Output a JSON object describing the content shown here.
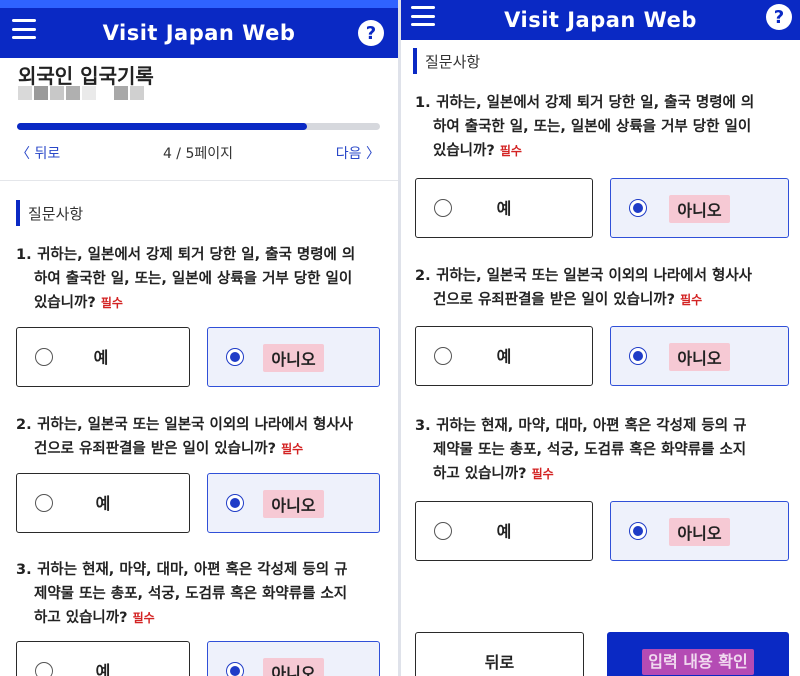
{
  "app": {
    "title": "Visit Japan Web",
    "help_glyph": "?",
    "colors": {
      "header": "#0a29c4",
      "accent": "#2f63ff",
      "required": "#d32323",
      "highlight": "#f6c9d4"
    }
  },
  "icons": {
    "menu": "menu-icon",
    "help": "help-icon",
    "radio": "radio-icon"
  },
  "left": {
    "page_title": "외국인 입국기록",
    "progress": {
      "current": 4,
      "total": 5,
      "fraction": 0.8
    },
    "pager": {
      "back": "〈  뒤로",
      "count": "4 / 5페이지",
      "next": "다음  〉"
    },
    "section_title": "질문사항",
    "questions": [
      {
        "num": "1.",
        "lines": [
          "귀하는, 일본에서 강제 퇴거 당한 일, 출국 명령에 의",
          "하여 출국한 일, 또는, 일본에 상륙을 거부 당한 일이",
          "있습니까?"
        ],
        "required": "필수",
        "yes": "예",
        "no": "아니오",
        "selected": "no"
      },
      {
        "num": "2.",
        "lines": [
          "귀하는, 일본국 또는 일본국 이외의 나라에서 형사사",
          "건으로 유죄판결을 받은 일이 있습니까?"
        ],
        "required": "필수",
        "yes": "예",
        "no": "아니오",
        "selected": "no"
      },
      {
        "num": "3.",
        "lines": [
          "귀하는 현재, 마약, 대마, 아편 혹은 각성제 등의 규",
          "제약물 또는 총포, 석궁, 도검류 혹은 화약류를 소지",
          "하고 있습니까?"
        ],
        "required": "필수",
        "yes": "예",
        "no": "아니오",
        "selected": "no"
      }
    ]
  },
  "right": {
    "section_title": "질문사항",
    "questions": [
      {
        "num": "1.",
        "lines": [
          "귀하는, 일본에서 강제 퇴거 당한 일, 출국 명령에 의",
          "하여 출국한 일, 또는, 일본에 상륙을 거부 당한 일이",
          "있습니까?"
        ],
        "required": "필수",
        "yes": "예",
        "no": "아니오",
        "selected": "no"
      },
      {
        "num": "2.",
        "lines": [
          "귀하는, 일본국 또는 일본국 이외의 나라에서 형사사",
          "건으로 유죄판결을 받은 일이 있습니까?"
        ],
        "required": "필수",
        "yes": "예",
        "no": "아니오",
        "selected": "no"
      },
      {
        "num": "3.",
        "lines": [
          "귀하는 현재, 마약, 대마, 아편 혹은 각성제 등의 규",
          "제약물 또는 총포, 석궁, 도검류 혹은 화약류를 소지",
          "하고 있습니까?"
        ],
        "required": "필수",
        "yes": "예",
        "no": "아니오",
        "selected": "no"
      }
    ],
    "buttons": {
      "back": "뒤로",
      "confirm": "입력 내용 확인"
    }
  }
}
